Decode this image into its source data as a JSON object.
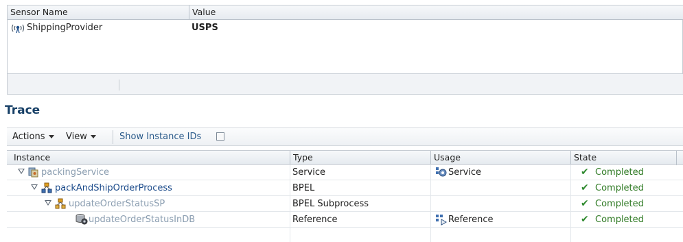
{
  "sensors": {
    "columns": [
      "Sensor Name",
      "Value"
    ],
    "rows": [
      {
        "name": "ShippingProvider",
        "value": "USPS",
        "icon": "sensor-antenna-icon"
      }
    ]
  },
  "trace": {
    "title": "Trace",
    "toolbar": {
      "actions_label": "Actions",
      "view_label": "View",
      "show_ids_label": "Show Instance IDs",
      "show_ids_checked": false
    },
    "columns": [
      "Instance",
      "Type",
      "Usage",
      "State"
    ],
    "rows": [
      {
        "instance": "packingService",
        "type": "Service",
        "usage": "Service",
        "state": "Completed",
        "icon": "service-icon",
        "usage_icon": "service-gear-icon"
      },
      {
        "instance": "packAndShipOrderProcess",
        "type": "BPEL",
        "usage": "",
        "state": "Completed",
        "icon": "bpel-process-icon"
      },
      {
        "instance": "updateOrderStatusSP",
        "type": "BPEL Subprocess",
        "usage": "",
        "state": "Completed",
        "icon": "bpel-subprocess-icon"
      },
      {
        "instance": "updateOrderStatusInDB",
        "type": "Reference",
        "usage": "Reference",
        "state": "Completed",
        "icon": "db-adapter-icon",
        "usage_icon": "reference-icon"
      }
    ],
    "colors": {
      "completed": "#2f7a24",
      "check": "#2f8a2f",
      "link_dim": "#8a9db0",
      "link_strong": "#1a4a8a"
    }
  }
}
